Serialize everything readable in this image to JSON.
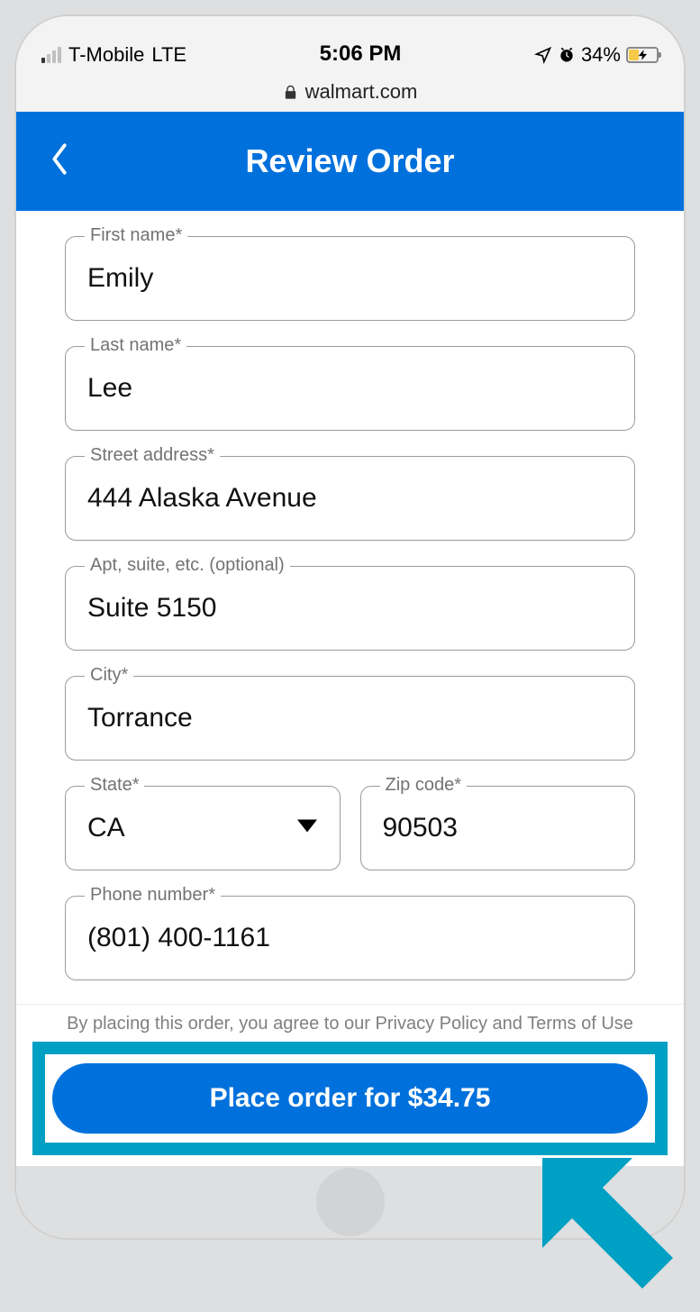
{
  "status": {
    "carrier": "T-Mobile",
    "network": "LTE",
    "time": "5:06 PM",
    "battery_pct": "34%"
  },
  "browser": {
    "domain": "walmart.com"
  },
  "header": {
    "title": "Review Order"
  },
  "form": {
    "first_name": {
      "label": "First name*",
      "value": "Emily"
    },
    "last_name": {
      "label": "Last name*",
      "value": "Lee"
    },
    "street": {
      "label": "Street address*",
      "value": "444 Alaska Avenue"
    },
    "apt": {
      "label": "Apt, suite, etc. (optional)",
      "value": "Suite 5150"
    },
    "city": {
      "label": "City*",
      "value": "Torrance"
    },
    "state": {
      "label": "State*",
      "value": "CA"
    },
    "zip": {
      "label": "Zip code*",
      "value": "90503"
    },
    "phone": {
      "label": "Phone number*",
      "value": "(801) 400-1161"
    }
  },
  "footer": {
    "agreement": "By placing this order, you agree to our Privacy Policy and Terms of Use",
    "place_order_label": "Place order for $34.75"
  },
  "colors": {
    "brand_blue": "#0071dc",
    "highlight_teal": "#00a0c4"
  }
}
